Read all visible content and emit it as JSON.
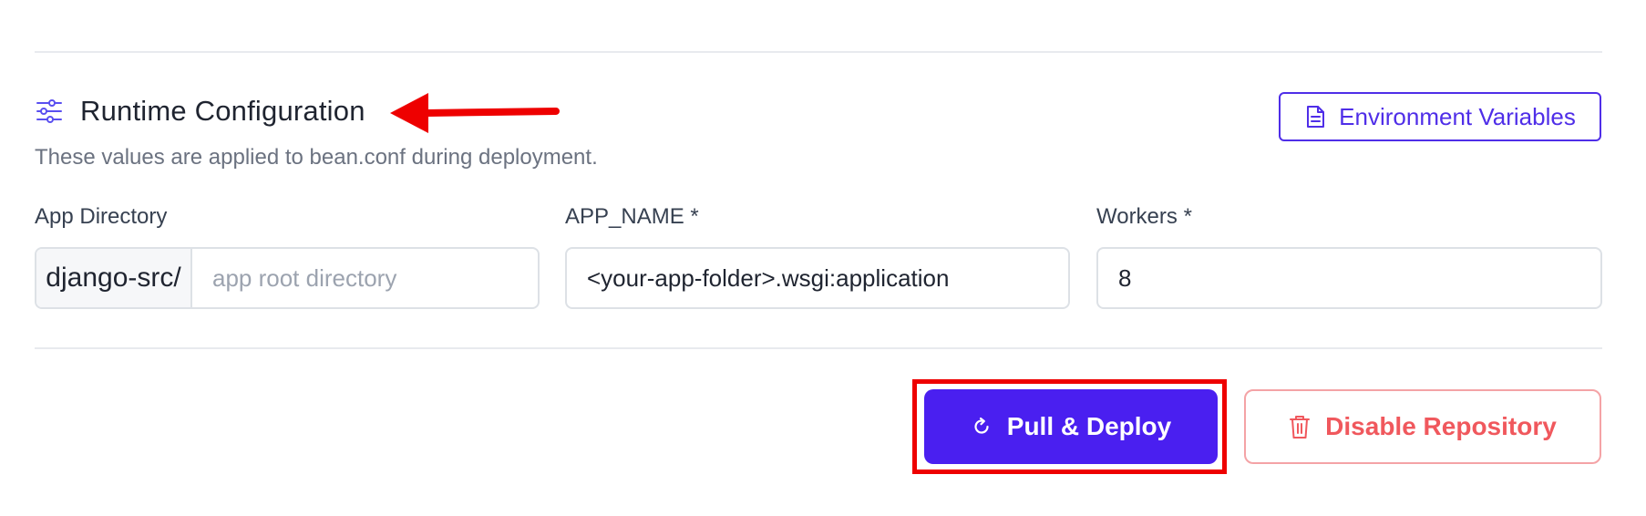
{
  "section": {
    "title": "Runtime Configuration",
    "description": "These values are applied to bean.conf during deployment.",
    "icon": "sliders-icon"
  },
  "env_button": {
    "label": "Environment Variables",
    "icon": "file-text-icon"
  },
  "fields": {
    "app_directory": {
      "label": "App Directory",
      "prefix": "django-src/",
      "placeholder": "app root directory",
      "value": ""
    },
    "app_name": {
      "label": "APP_NAME *",
      "value": "<your-app-folder>.wsgi:application"
    },
    "workers": {
      "label": "Workers *",
      "value": "8"
    }
  },
  "actions": {
    "deploy": {
      "label": "Pull & Deploy",
      "icon": "refresh-icon"
    },
    "disable": {
      "label": "Disable Repository",
      "icon": "trash-icon"
    }
  },
  "colors": {
    "primary": "#4a1ff0",
    "danger": "#f0585d",
    "annotation": "#ee0000"
  }
}
